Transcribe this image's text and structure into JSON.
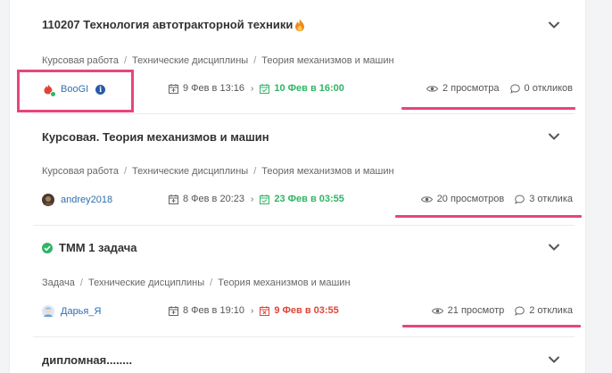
{
  "colors": {
    "accent_highlight": "#e8457a",
    "green": "#2fb564",
    "red": "#e0433a",
    "link": "#2f6fb0"
  },
  "cards": [
    {
      "title": "110207 Технология автотракторной техники",
      "title_icon": "fire-icon",
      "crumbs": [
        "Курсовая работа",
        "Технические дисциплины",
        "Теория механизмов и машин"
      ],
      "user": "BooGI",
      "published": "9 Фев в 13:16",
      "deadline": "10 Фев в 16:00",
      "deadline_status": "green",
      "views": "2 просмотра",
      "responses": "0 откликов"
    },
    {
      "title": "Курсовая. Теория механизмов и машин",
      "crumbs": [
        "Курсовая работа",
        "Технические дисциплины",
        "Теория механизмов и машин"
      ],
      "user": "andrey2018",
      "published": "8 Фев в 20:23",
      "deadline": "23 Фев в 03:55",
      "deadline_status": "green",
      "views": "20 просмотров",
      "responses": "3 отклика"
    },
    {
      "title": "ТММ 1 задача",
      "title_icon": "check-circle-icon",
      "crumbs": [
        "Задача",
        "Технические дисциплины",
        "Теория механизмов и машин"
      ],
      "user": "Дарья_Я",
      "published": "8 Фев в 19:10",
      "deadline": "9 Фев в 03:55",
      "deadline_status": "red",
      "views": "21 просмотр",
      "responses": "2 отклика"
    },
    {
      "title": "дипломная........"
    }
  ]
}
